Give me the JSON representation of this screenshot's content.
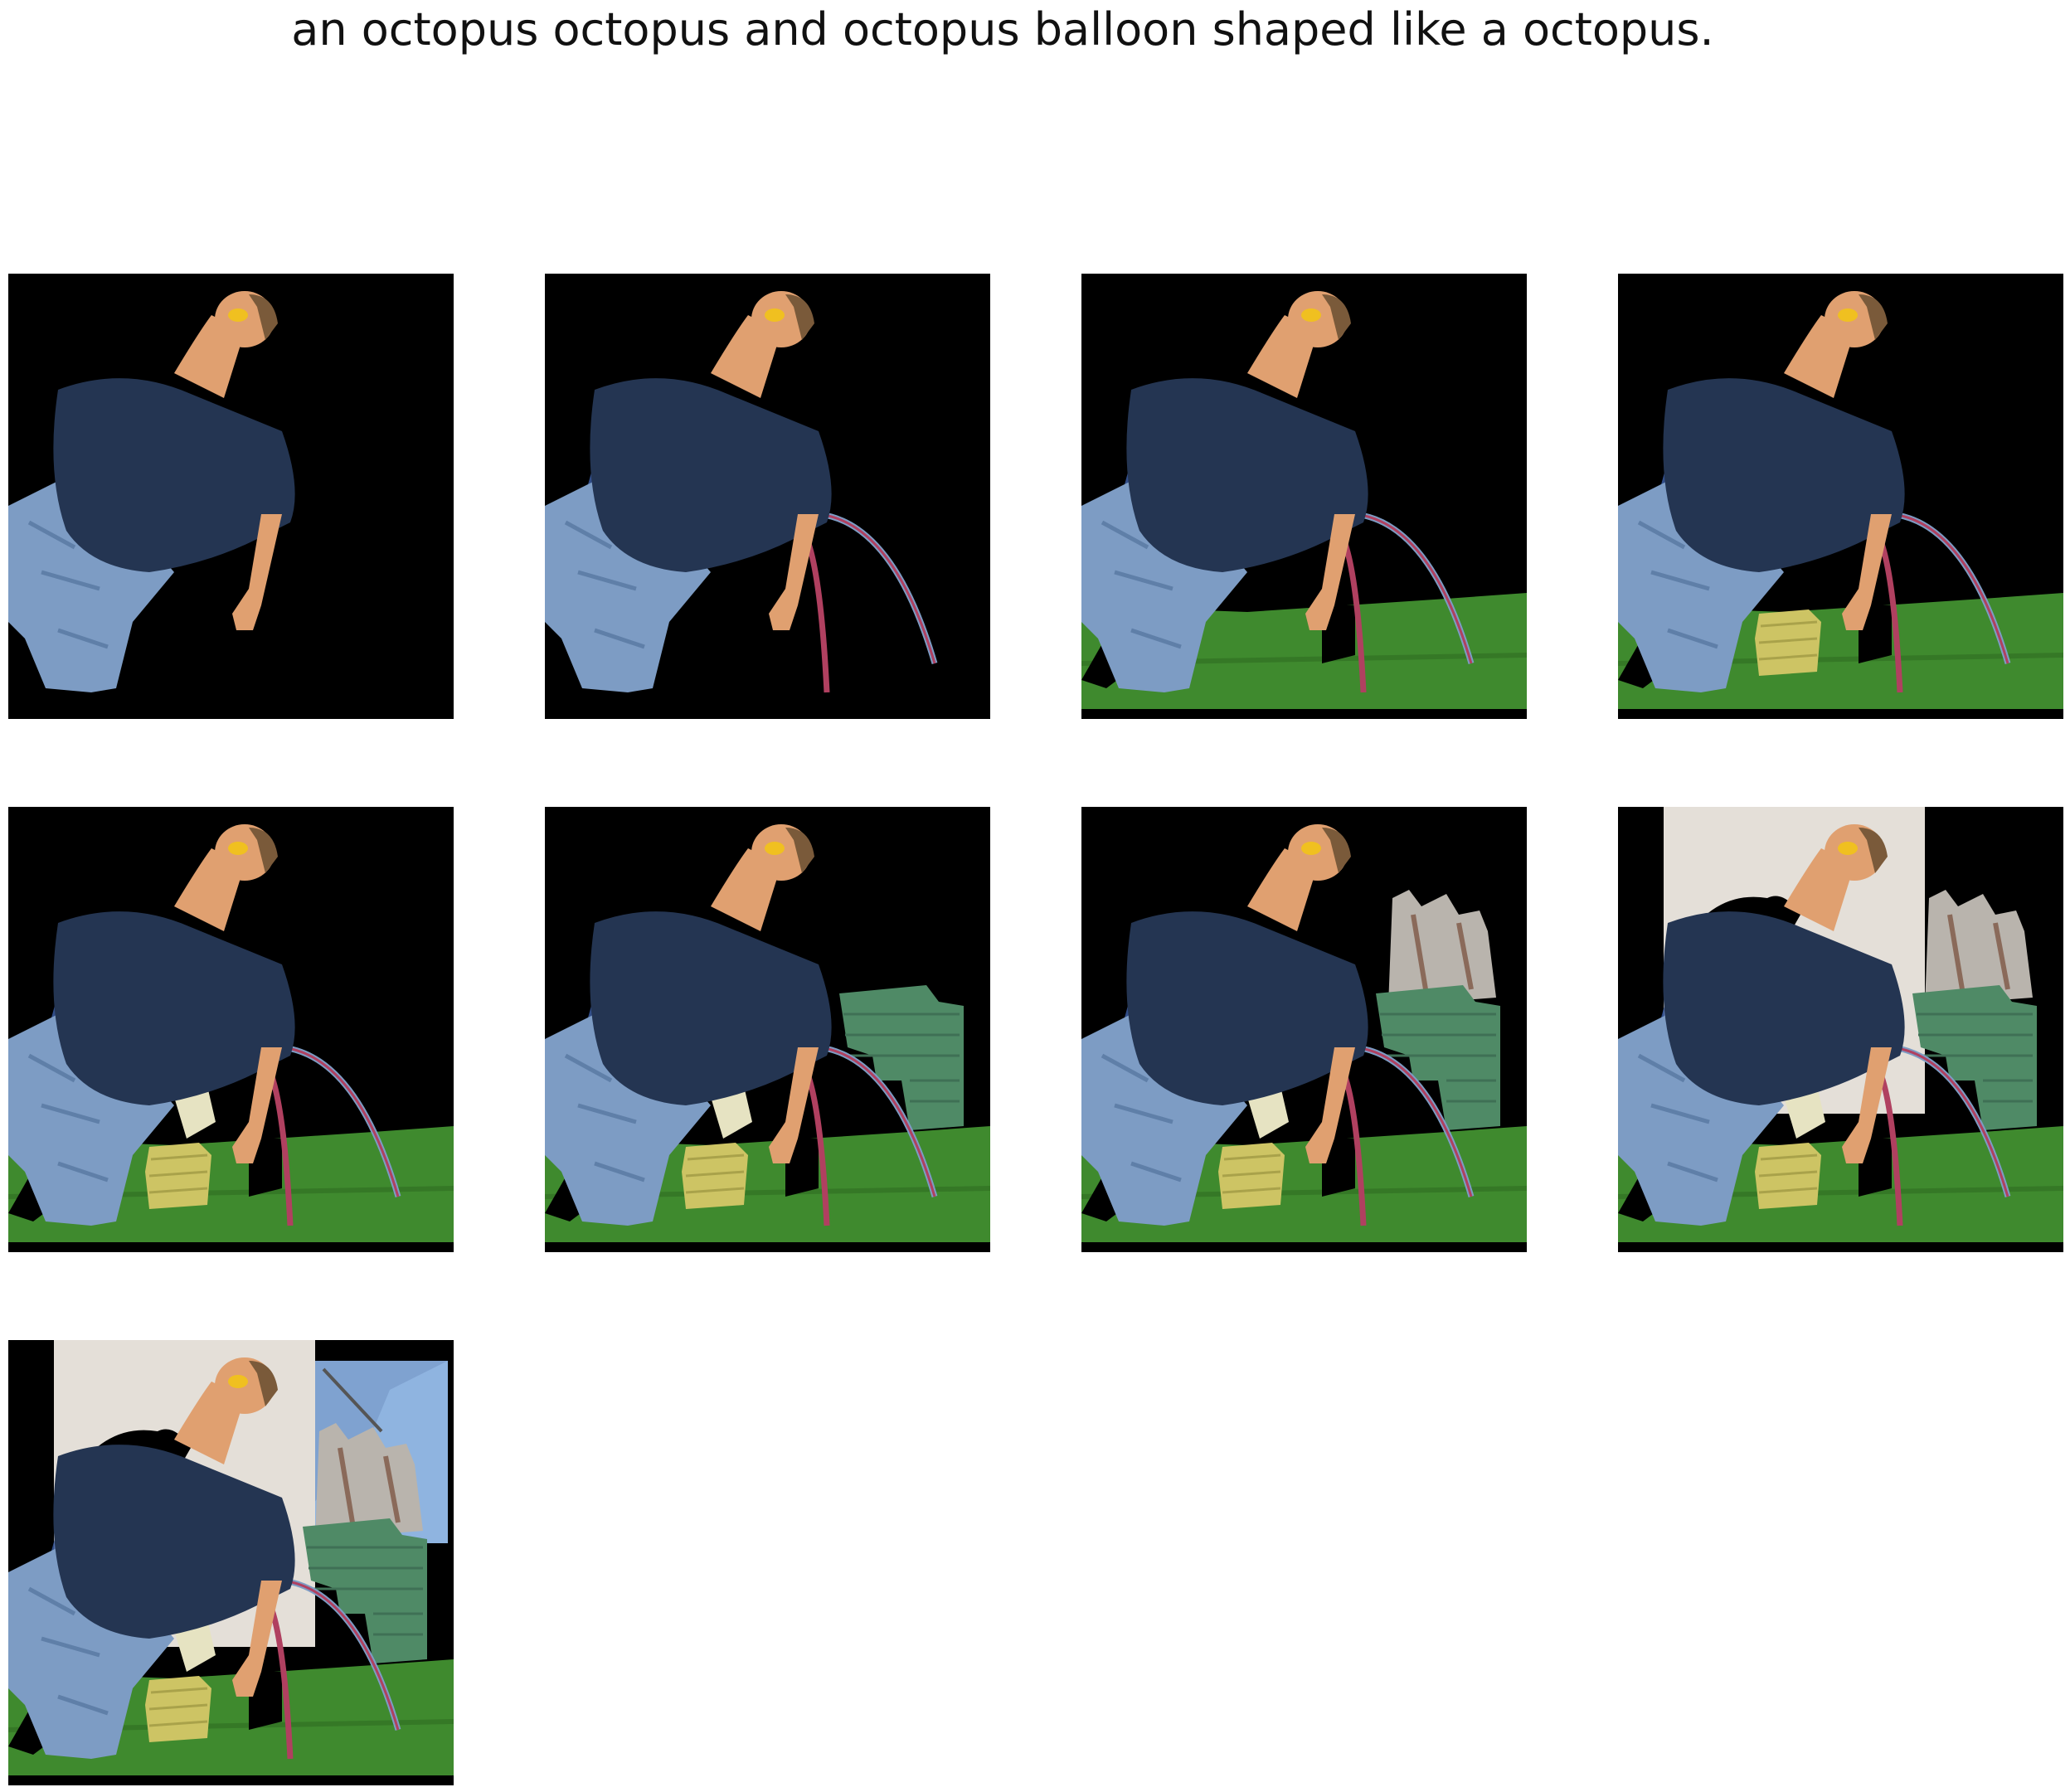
{
  "figure": {
    "title": "an octopus octopus and octopus balloon shaped like a octopus."
  },
  "panels": [
    {
      "step": 1,
      "layers": [
        "person"
      ]
    },
    {
      "step": 2,
      "layers": [
        "person",
        "strings"
      ]
    },
    {
      "step": 3,
      "layers": [
        "person",
        "strings",
        "grass"
      ]
    },
    {
      "step": 4,
      "layers": [
        "person",
        "strings",
        "grass",
        "yellow-box"
      ]
    },
    {
      "step": 5,
      "layers": [
        "person",
        "strings",
        "grass",
        "yellow-box",
        "pale-field"
      ]
    },
    {
      "step": 6,
      "layers": [
        "person",
        "strings",
        "grass",
        "yellow-box",
        "pale-field",
        "green-wall"
      ]
    },
    {
      "step": 7,
      "layers": [
        "person",
        "strings",
        "grass",
        "yellow-box",
        "pale-field",
        "green-wall",
        "fence"
      ]
    },
    {
      "step": 8,
      "layers": [
        "person",
        "strings",
        "grass",
        "yellow-box",
        "pale-field",
        "green-wall",
        "fence",
        "concrete-wall"
      ]
    },
    {
      "step": 9,
      "layers": [
        "person",
        "strings",
        "grass",
        "yellow-box",
        "pale-field",
        "green-wall",
        "fence",
        "concrete-wall",
        "sky"
      ]
    }
  ],
  "colors": {
    "background": "#000000",
    "shirt": "#243552",
    "jeans": "#7d9cc4",
    "skin": "#e0a070",
    "grass": "#3f8a2e",
    "string": "#b04060",
    "box": "#cdc464",
    "concrete": "#e4dfd8",
    "green_wall": "#4f8a66",
    "sky": "#8fb4e0"
  }
}
